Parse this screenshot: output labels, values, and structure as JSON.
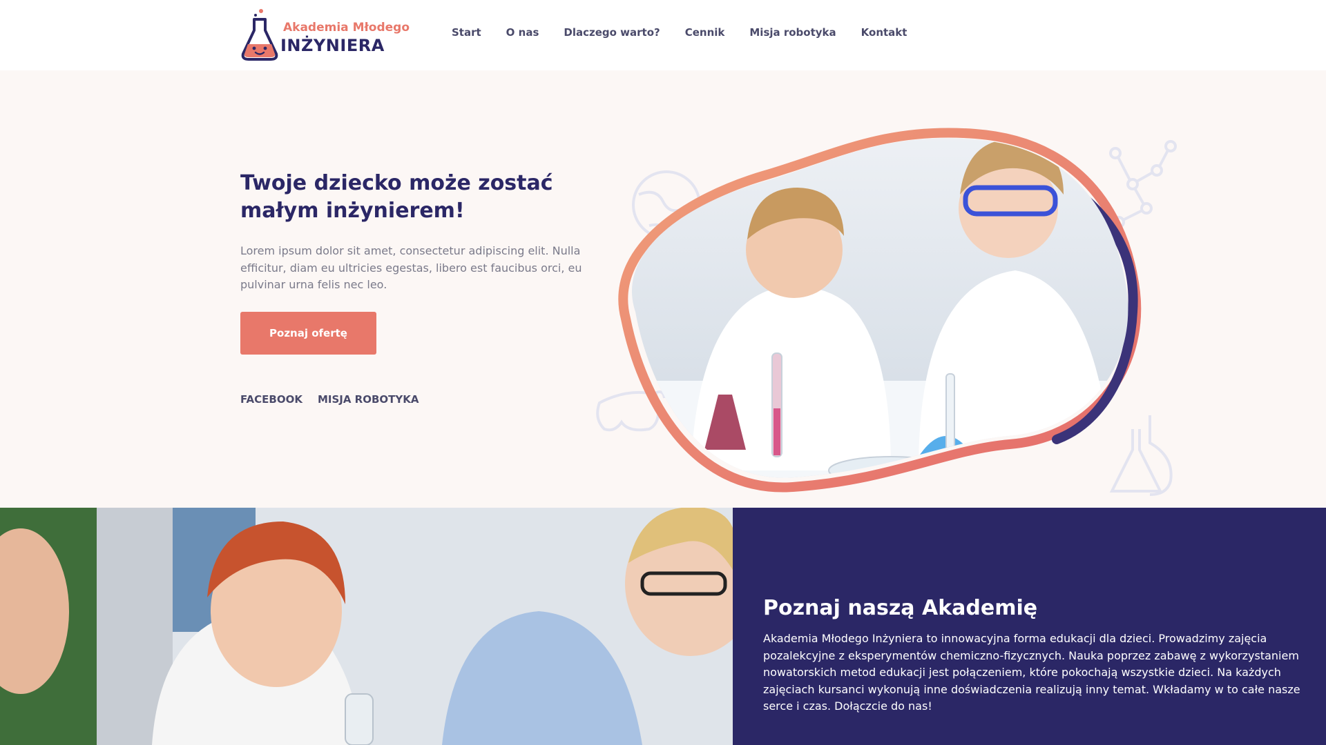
{
  "brand": {
    "line1": "Akademia Młodego",
    "line2": "INŻYNIERA",
    "accent": "#e8786a",
    "primary": "#2b2766"
  },
  "nav": {
    "items": [
      {
        "label": "Start"
      },
      {
        "label": "O nas"
      },
      {
        "label": "Dlaczego warto?"
      },
      {
        "label": "Cennik"
      },
      {
        "label": "Misja robotyka"
      },
      {
        "label": "Kontakt"
      }
    ]
  },
  "hero": {
    "title": "Twoje dziecko może zostać małym inżynierem!",
    "text": "Lorem ipsum dolor sit amet, consectetur adipiscing elit. Nulla efficitur, diam eu ultricies egestas, libero est faucibus orci, eu pulvinar urna felis nec leo.",
    "cta": "Poznaj ofertę",
    "links": [
      {
        "label": "FACEBOOK"
      },
      {
        "label": "MISJA ROBOTYKA"
      }
    ],
    "decor_icons": [
      "globe-icon",
      "molecule-icon",
      "goggles-icon",
      "flask-icon"
    ]
  },
  "about": {
    "title": "Poznaj naszą Akademię",
    "text": "Akademia Młodego Inżyniera to innowacyjna forma edukacji dla dzieci. Prowadzimy zajęcia pozalekcyjne z eksperymentów chemiczno-fizycznych. Nauka poprzez zabawę z wykorzystaniem nowatorskich metod edukacji jest połączeniem, które pokochają wszystkie dzieci. Na każdych zajęciach kursanci wykonują inne doświadczenia realizują inny temat. Wkładamy w to całe nasze serce i czas. Dołączcie do nas!"
  }
}
